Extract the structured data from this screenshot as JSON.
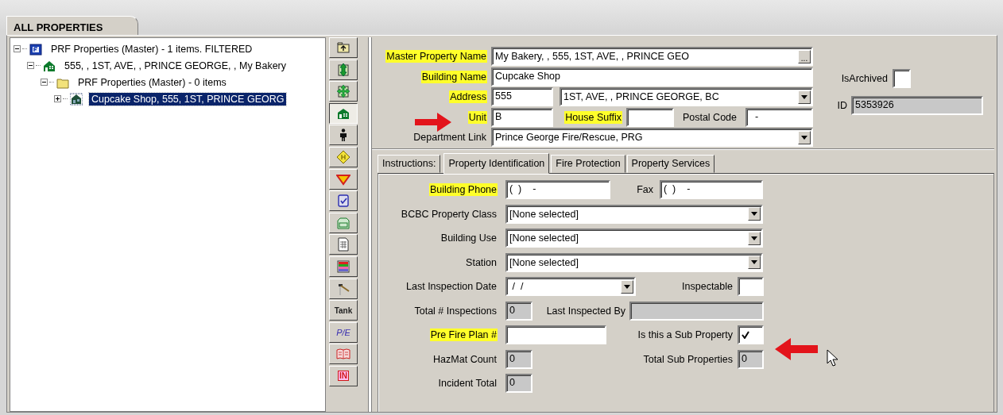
{
  "window_tab": "ALL PROPERTIES",
  "tree": [
    {
      "label": "PRF  Properties (Master) - 1 items. FILTERED",
      "kind": "filter",
      "expanded": true,
      "selected": false,
      "children": [
        {
          "label": "555, , 1ST, AVE, , PRINCE GEORGE, , My Bakery",
          "kind": "building",
          "expanded": true,
          "selected": false,
          "children": [
            {
              "label": "PRF  Properties (Master) - 0 items",
              "kind": "folder",
              "expanded": true,
              "selected": false,
              "children": [
                {
                  "label": "Cupcake Shop, 555, 1ST, PRINCE GEORG",
                  "kind": "sub",
                  "expanded": false,
                  "selected": true
                }
              ]
            }
          ]
        }
      ]
    }
  ],
  "toolbar": [
    {
      "kind": "icon",
      "selected": false
    },
    {
      "kind": "icon",
      "selected": false
    },
    {
      "kind": "icon",
      "selected": false
    },
    {
      "kind": "icon",
      "selected": true
    },
    {
      "kind": "icon",
      "selected": false
    },
    {
      "kind": "icon",
      "selected": false
    },
    {
      "kind": "icon",
      "selected": false
    },
    {
      "kind": "icon",
      "selected": false
    },
    {
      "kind": "icon",
      "selected": false
    },
    {
      "kind": "icon",
      "selected": false
    },
    {
      "kind": "icon",
      "selected": false
    },
    {
      "kind": "icon",
      "selected": false
    },
    {
      "kind": "text",
      "label": "Tank",
      "selected": false
    },
    {
      "kind": "text",
      "label": "P/E",
      "selected": false
    },
    {
      "kind": "icon",
      "selected": false
    },
    {
      "kind": "text",
      "label": "IN",
      "selected": false
    }
  ],
  "header": [
    [
      {
        "kind": "label",
        "text": "Master Property Name",
        "highlighted": true
      },
      {
        "kind": "browse",
        "value": "My Bakery, , 555, 1ST, AVE, , PRINCE GEO",
        "button": "..."
      }
    ],
    [
      {
        "kind": "label",
        "text": "Building Name",
        "highlighted": true
      },
      {
        "kind": "text",
        "value": "Cupcake Shop"
      }
    ],
    [
      {
        "kind": "label",
        "text": "Address",
        "highlighted": true
      },
      {
        "kind": "text",
        "value": "555"
      },
      {
        "kind": "select",
        "value": "1ST, AVE, , PRINCE GEORGE, BC"
      }
    ],
    [
      {
        "kind": "label",
        "text": "Unit",
        "highlighted": true
      },
      {
        "kind": "text",
        "value": "B"
      },
      {
        "kind": "label",
        "text": "House Suffix",
        "highlighted": true
      },
      {
        "kind": "text"
      },
      {
        "kind": "label",
        "text": "Postal Code",
        "highlighted": false
      },
      {
        "kind": "text",
        "value": "  -"
      }
    ],
    [
      {
        "kind": "label",
        "text": "Department Link",
        "highlighted": false
      },
      {
        "kind": "select",
        "value": "Prince George Fire/Rescue, PRG"
      }
    ]
  ],
  "side": [
    [
      {
        "kind": "label",
        "text": "IsArchived",
        "highlighted": false
      },
      {
        "kind": "check",
        "checked": false
      }
    ],
    [
      {
        "kind": "label",
        "text": "ID",
        "highlighted": false
      },
      {
        "kind": "readonly",
        "value": "5353926"
      }
    ]
  ],
  "tabs": [
    {
      "label": "Instructions:",
      "kind": "caption"
    },
    {
      "label": "Property Identification",
      "kind": "tab",
      "selected": true
    },
    {
      "label": "Fire Protection",
      "kind": "tab",
      "selected": false
    },
    {
      "label": "Property Services",
      "kind": "tab",
      "selected": false
    }
  ],
  "body": [
    [
      {
        "kind": "label",
        "text": "Building Phone",
        "highlighted": true
      },
      {
        "kind": "text",
        "value": "(  )    -"
      },
      {
        "kind": "label",
        "text": "Fax",
        "highlighted": false
      },
      {
        "kind": "text",
        "value": "(  )    -"
      }
    ],
    [
      {
        "kind": "label",
        "text": "BCBC Property Class",
        "highlighted": false
      },
      {
        "kind": "select",
        "value": "[None selected]"
      }
    ],
    [
      {
        "kind": "label",
        "text": "Building Use",
        "highlighted": false
      },
      {
        "kind": "select",
        "value": "[None selected]"
      }
    ],
    [
      {
        "kind": "label",
        "text": "Station",
        "highlighted": false
      },
      {
        "kind": "select",
        "value": "[None selected]"
      }
    ],
    [
      {
        "kind": "label",
        "text": "Last Inspection Date",
        "highlighted": false
      },
      {
        "kind": "select",
        "value": " /  /"
      },
      {
        "kind": "label",
        "text": "Inspectable",
        "highlighted": false
      },
      {
        "kind": "check",
        "checked": false
      }
    ],
    [
      {
        "kind": "label",
        "text": "Total # Inspections",
        "highlighted": false
      },
      {
        "kind": "readonly",
        "value": "0"
      },
      {
        "kind": "label",
        "text": "Last Inspected By",
        "highlighted": false
      },
      {
        "kind": "readonly"
      }
    ],
    [
      {
        "kind": "label",
        "text": "Pre Fire Plan #",
        "highlighted": true
      },
      {
        "kind": "text"
      },
      {
        "kind": "label",
        "text": "Is this a Sub Property",
        "highlighted": false
      },
      {
        "kind": "check",
        "checked": true
      }
    ],
    [
      {
        "kind": "label",
        "text": "HazMat Count",
        "highlighted": false
      },
      {
        "kind": "readonly",
        "value": "0"
      },
      {
        "kind": "label",
        "text": "Total Sub Properties",
        "highlighted": false
      },
      {
        "kind": "readonly",
        "value": "0"
      }
    ],
    [
      {
        "kind": "label",
        "text": "Incident Total",
        "highlighted": false
      },
      {
        "kind": "readonly",
        "value": "0"
      }
    ]
  ]
}
